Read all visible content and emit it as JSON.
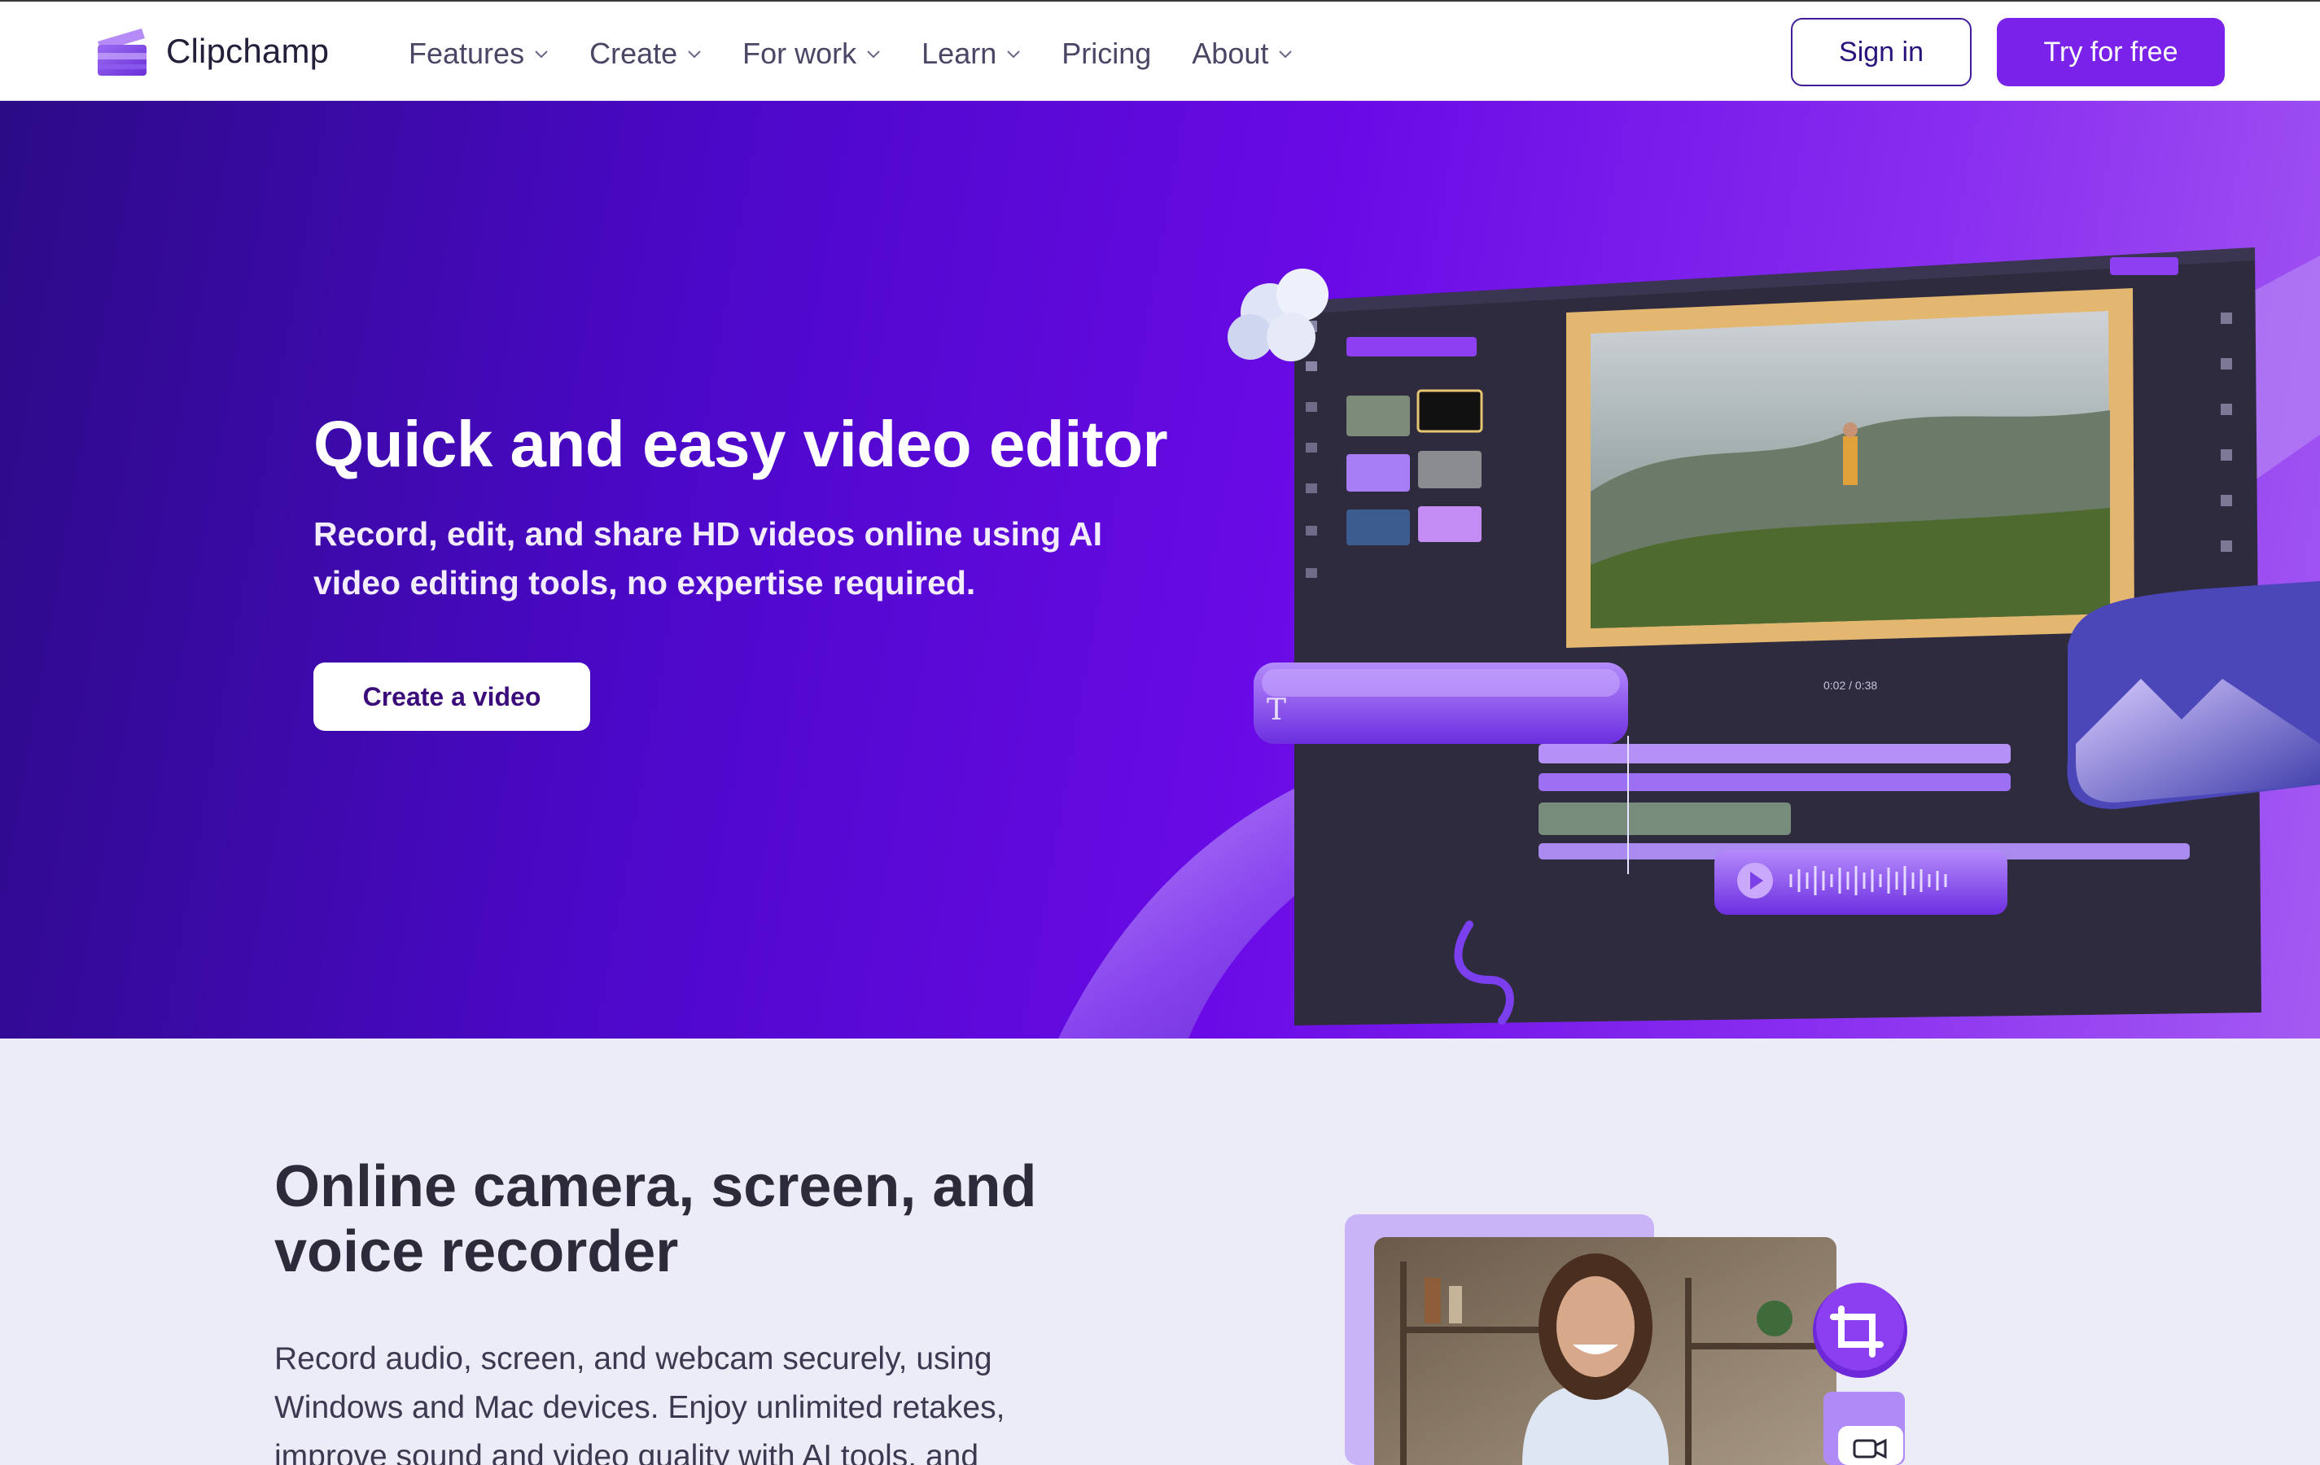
{
  "nav": {
    "brand": "Clipchamp",
    "items": [
      {
        "label": "Features",
        "dropdown": true
      },
      {
        "label": "Create",
        "dropdown": true
      },
      {
        "label": "For work",
        "dropdown": true
      },
      {
        "label": "Learn",
        "dropdown": true
      },
      {
        "label": "Pricing",
        "dropdown": false
      },
      {
        "label": "About",
        "dropdown": true
      }
    ],
    "signin_label": "Sign in",
    "try_label": "Try for free"
  },
  "hero": {
    "title": "Quick and easy video editor",
    "subtitle": "Record, edit, and share HD videos online using AI video editing tools, no expertise required.",
    "cta_label": "Create a video",
    "editor_timecode": "0:02 / 0:38"
  },
  "section2": {
    "title": "Online camera, screen, and voice recorder",
    "body": "Record audio, screen, and webcam securely, using Windows and Mac devices. Enjoy unlimited retakes, improve sound and video quality with AI tools, and"
  },
  "colors": {
    "accent": "#7a22ea",
    "signin_border": "#3f1d99",
    "section_bg": "#ecebf8"
  }
}
